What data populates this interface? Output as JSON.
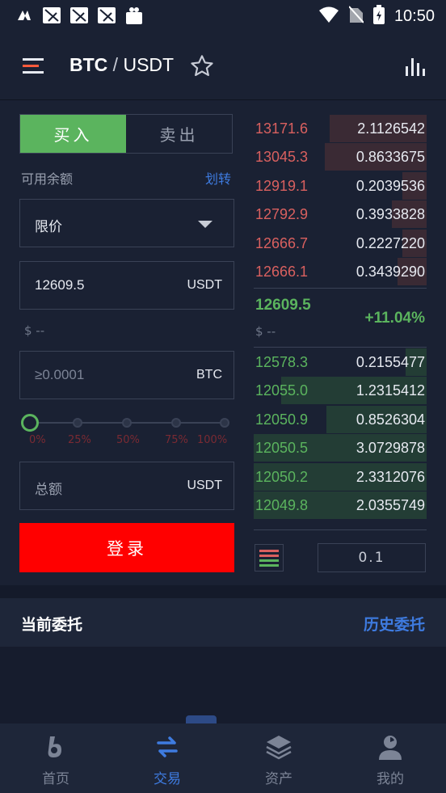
{
  "status_bar": {
    "time": "10:50"
  },
  "header": {
    "base": "BTC",
    "separator": " / ",
    "quote": "USDT"
  },
  "trade": {
    "tab_buy": "买入",
    "tab_sell": "卖出",
    "available_label": "可用余额",
    "transfer_link": "划转",
    "order_type": "限价",
    "price_value": "12609.5",
    "price_unit": "USDT",
    "usd_hint": "$ --",
    "amount_placeholder": "≥0.0001",
    "amount_unit": "BTC",
    "slider_level": 0,
    "percents": [
      "0%",
      "25%",
      "50%",
      "75%",
      "100%"
    ],
    "total_label": "总额",
    "total_unit": "USDT",
    "login_button": "登录"
  },
  "order_book": {
    "asks": [
      {
        "price": "13171.6",
        "qty": "2.1126542",
        "depth": 0.56
      },
      {
        "price": "13045.3",
        "qty": "0.8633675",
        "depth": 0.59
      },
      {
        "price": "12919.1",
        "qty": "0.2039536",
        "depth": 0.14
      },
      {
        "price": "12792.9",
        "qty": "0.3933828",
        "depth": 0.2
      },
      {
        "price": "12666.7",
        "qty": "0.2227220",
        "depth": 0.14
      },
      {
        "price": "12666.1",
        "qty": "0.3439290",
        "depth": 0.17
      }
    ],
    "last_price": "12609.5",
    "change": "+11.04%",
    "usd_hint": "$ --",
    "bids": [
      {
        "price": "12578.3",
        "qty": "0.2155477",
        "depth": 0.12
      },
      {
        "price": "12055.0",
        "qty": "1.2315412",
        "depth": 0.84
      },
      {
        "price": "12050.9",
        "qty": "0.8526304",
        "depth": 0.58
      },
      {
        "price": "12050.5",
        "qty": "3.0729878",
        "depth": 1.0
      },
      {
        "price": "12050.2",
        "qty": "2.3312076",
        "depth": 1.0
      },
      {
        "price": "12049.8",
        "qty": "2.0355749",
        "depth": 1.0
      }
    ],
    "precision": "0.1"
  },
  "orders": {
    "title": "当前委托",
    "history": "历史委托"
  },
  "nav": {
    "home": "首页",
    "trade": "交易",
    "assets": "资产",
    "mine": "我的"
  },
  "colors": {
    "buy": "#5bb45e",
    "sell": "#d9605f",
    "accent": "#3e7be0",
    "login": "#ff0000"
  }
}
